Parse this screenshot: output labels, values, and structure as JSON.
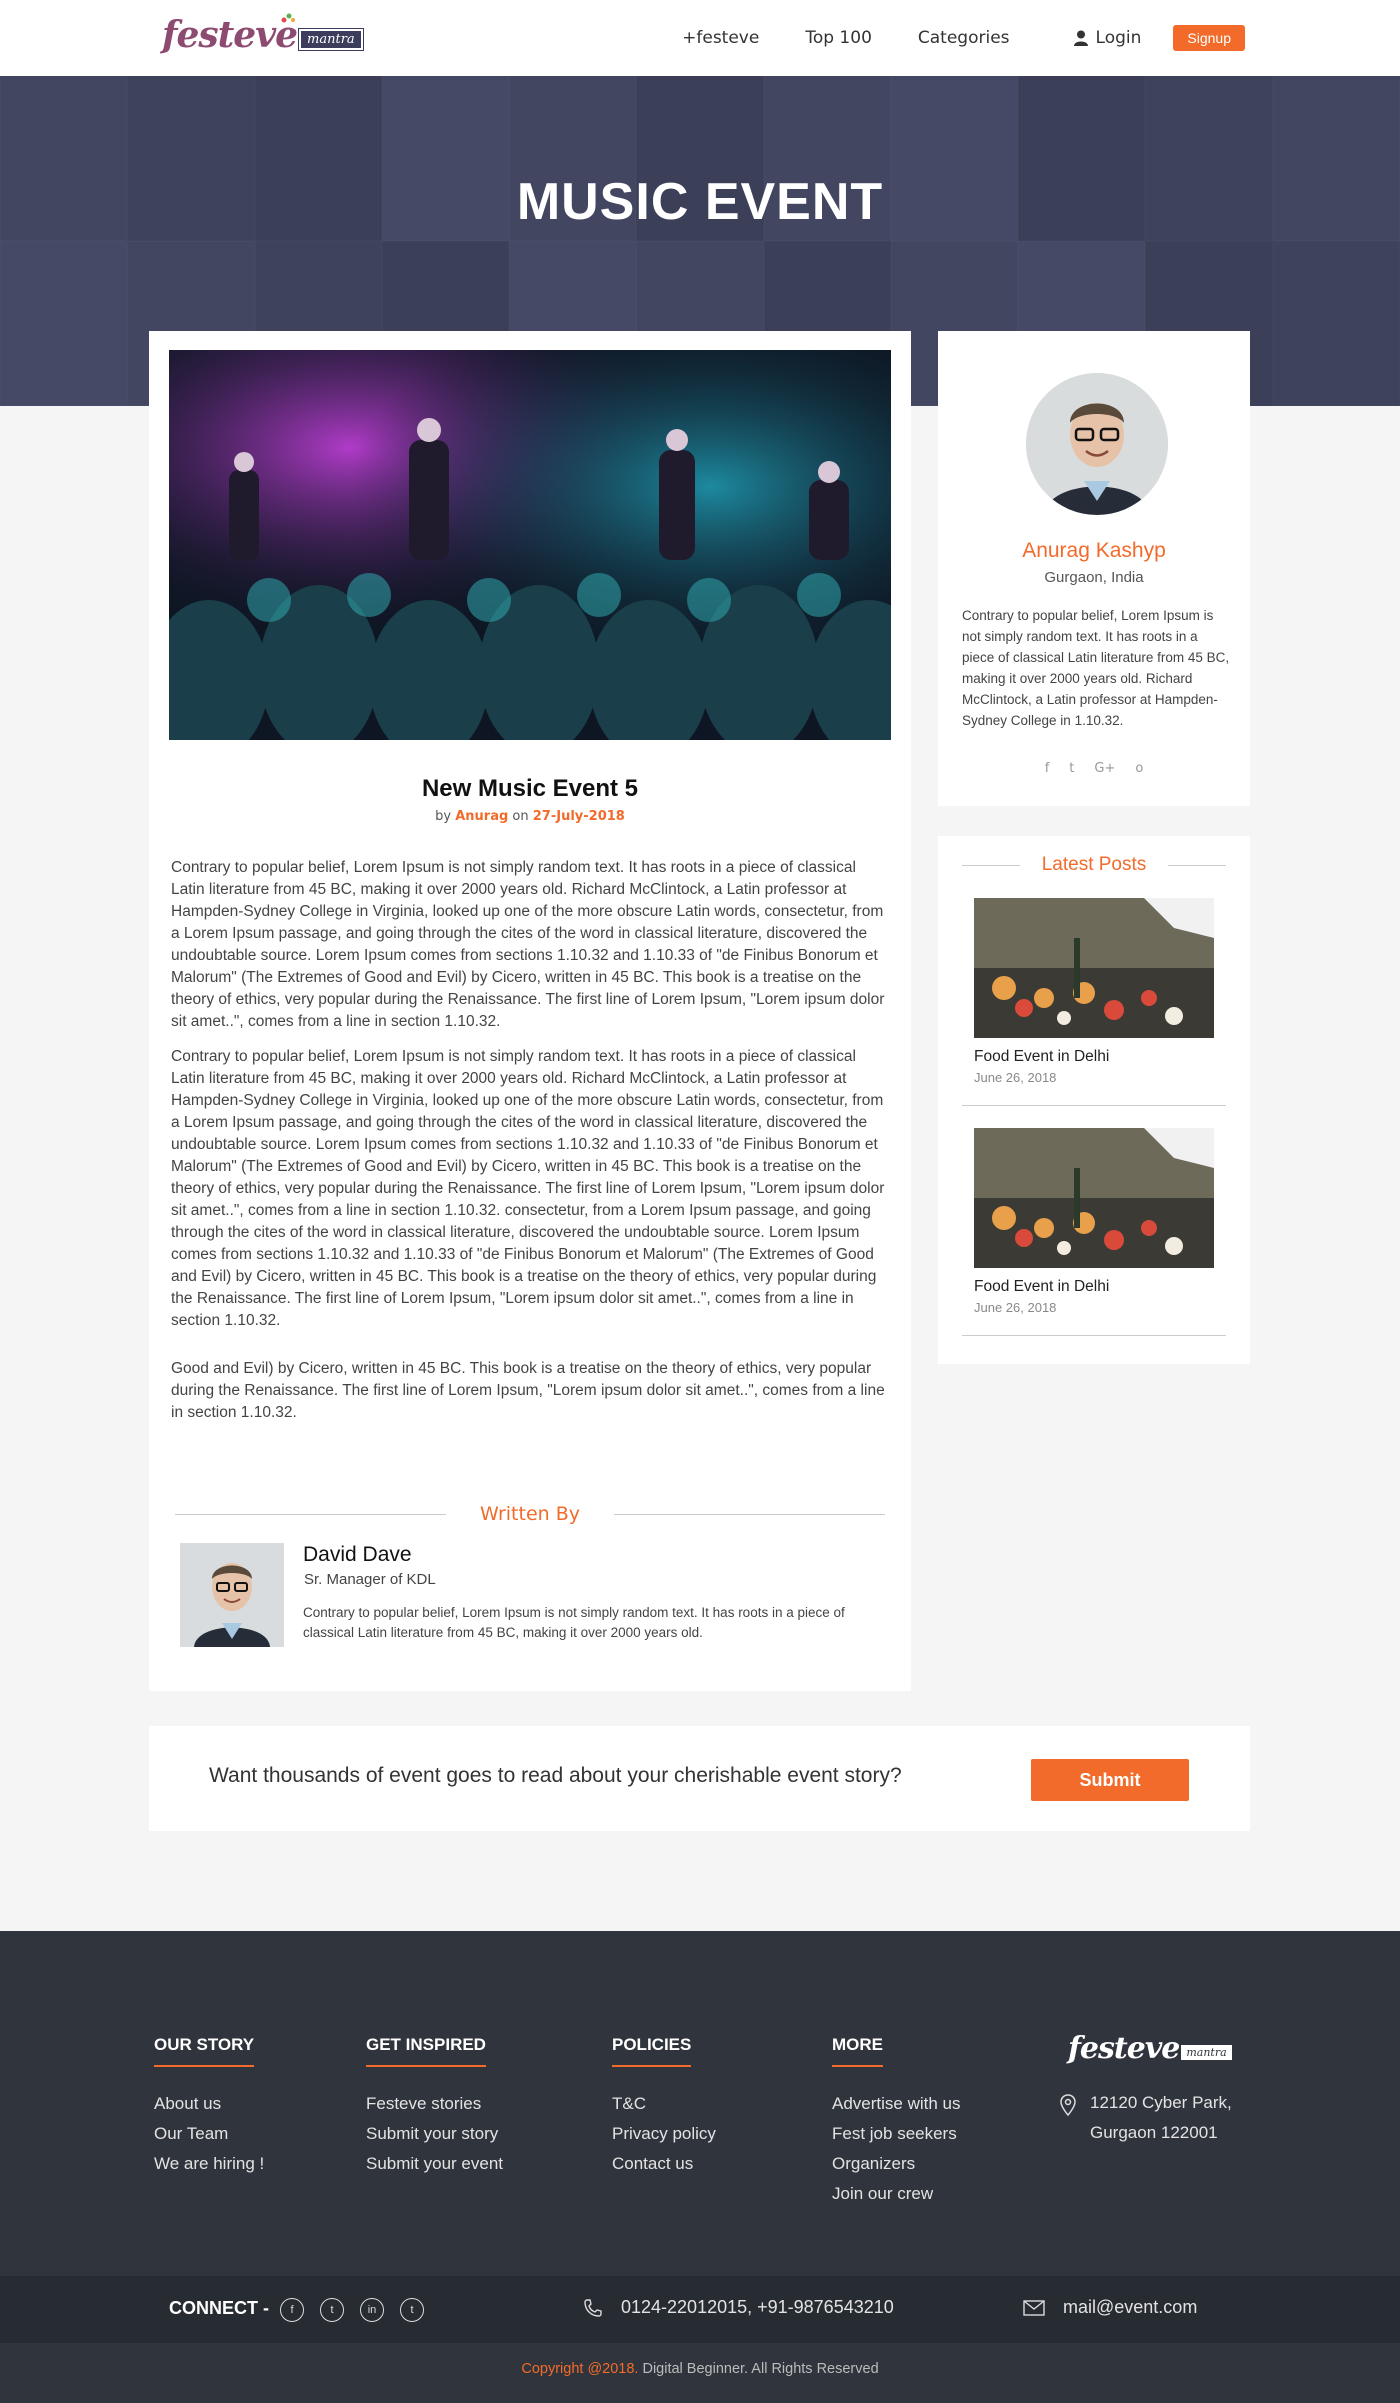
{
  "header": {
    "logo_text": "festeve",
    "logo_badge": "mantra",
    "nav": [
      "+festeve",
      "Top 100",
      "Categories"
    ],
    "login": "Login",
    "signup": "Signup"
  },
  "hero": {
    "title": "MUSIC EVENT"
  },
  "event": {
    "title": "New Music Event 5",
    "by_prefix": "by",
    "author": "Anurag",
    "on_word": "on",
    "date": "27-July-2018",
    "paragraphs": [
      "Contrary to popular belief, Lorem Ipsum is not simply random text. It has roots in a piece of classical Latin literature from 45 BC, making it over 2000 years old. Richard McClintock, a Latin professor at Hampden-Sydney College in Virginia, looked up one of the more obscure Latin words, consectetur, from a Lorem Ipsum passage, and going through the cites of the word in classical literature, discovered the undoubtable source. Lorem Ipsum comes from sections 1.10.32 and 1.10.33 of \"de Finibus Bonorum et Malorum\" (The Extremes of Good and Evil) by Cicero, written in 45 BC. This book is a treatise on the theory of ethics, very popular during the Renaissance. The first line of Lorem Ipsum, \"Lorem ipsum dolor sit amet..\", comes from a line in section 1.10.32.",
      "Contrary to popular belief, Lorem Ipsum is not simply random text. It has roots in a piece of classical Latin literature from 45 BC, making it over 2000 years old. Richard McClintock, a Latin professor at Hampden-Sydney College in Virginia, looked up one of the more obscure Latin words, consectetur, from a Lorem Ipsum passage, and going through the cites of the word in classical literature, discovered the undoubtable source. Lorem Ipsum comes from sections 1.10.32 and 1.10.33 of \"de Finibus Bonorum et Malorum\" (The Extremes of Good and Evil) by Cicero, written in 45 BC. This book is a treatise on the theory of ethics, very popular during the Renaissance. The first line of Lorem Ipsum, \"Lorem ipsum dolor sit amet..\", comes from a line in section 1.10.32. consectetur, from a Lorem Ipsum passage, and going through the cites of the word in classical literature, discovered the undoubtable source. Lorem Ipsum comes from sections 1.10.32 and 1.10.33 of \"de Finibus Bonorum et Malorum\" (The Extremes of Good and Evil) by Cicero, written in 45 BC. This book is a treatise on the theory of ethics, very popular during the Renaissance. The first line of Lorem Ipsum, \"Lorem ipsum dolor sit amet..\", comes from a line in section 1.10.32.",
      "Good and Evil) by Cicero, written in 45 BC. This book is a treatise on the theory of ethics, very popular during the Renaissance. The first line of Lorem Ipsum, \"Lorem ipsum dolor sit amet..\", comes from a line in section 1.10.32."
    ],
    "written_by_heading": "Written By",
    "writer": {
      "name": "David Dave",
      "role": "Sr. Manager of KDL",
      "bio": "Contrary to popular belief, Lorem Ipsum is not simply random text. It has roots in a piece of classical Latin literature from 45 BC, making it over 2000 years old."
    }
  },
  "profile": {
    "name": "Anurag Kashyp",
    "location": "Gurgaon, India",
    "bio": "Contrary to popular belief, Lorem Ipsum is not simply random text. It has roots in a piece of classical Latin literature from 45 BC, making it over 2000 years old. Richard McClintock, a Latin professor at Hampden-Sydney College in  1.10.32.",
    "social": [
      "f",
      "t",
      "G+",
      "o"
    ]
  },
  "latest_posts": {
    "heading": "Latest Posts",
    "items": [
      {
        "title": "Food Event in Delhi",
        "date": "June 26, 2018"
      },
      {
        "title": "Food Event in Delhi",
        "date": "June 26, 2018"
      }
    ]
  },
  "cta": {
    "text": "Want thousands of event goes to read about your cherishable event story?",
    "button": "Submit"
  },
  "footer": {
    "columns": [
      {
        "heading": "OUR STORY",
        "links": [
          "About us",
          "Our Team",
          "We are hiring !"
        ]
      },
      {
        "heading": "GET INSPIRED",
        "links": [
          "Festeve stories",
          "Submit your story",
          "Submit your event"
        ]
      },
      {
        "heading": "POLICIES",
        "links": [
          "T&C",
          "Privacy policy",
          "Contact us"
        ]
      },
      {
        "heading": "MORE",
        "links": [
          "Advertise with us",
          "Fest job seekers",
          "Organizers",
          "Join our crew"
        ]
      }
    ],
    "logo_text": "festeve",
    "logo_badge": "mantra",
    "address_line1": "12120 Cyber Park,",
    "address_line2": "Gurgaon 122001",
    "connect_label": "CONNECT -",
    "social": [
      "f",
      "t",
      "in",
      "t"
    ],
    "phone": "0124-22012015, +91-9876543210",
    "email": "mail@event.com",
    "copyright_hl": "Copyright @2018.",
    "copyright_rest": " Digital Beginner. All Rights Reserved"
  },
  "colors": {
    "accent": "#f26b2a",
    "footer_bg": "#30353d",
    "hero_bg": "#464a62"
  }
}
